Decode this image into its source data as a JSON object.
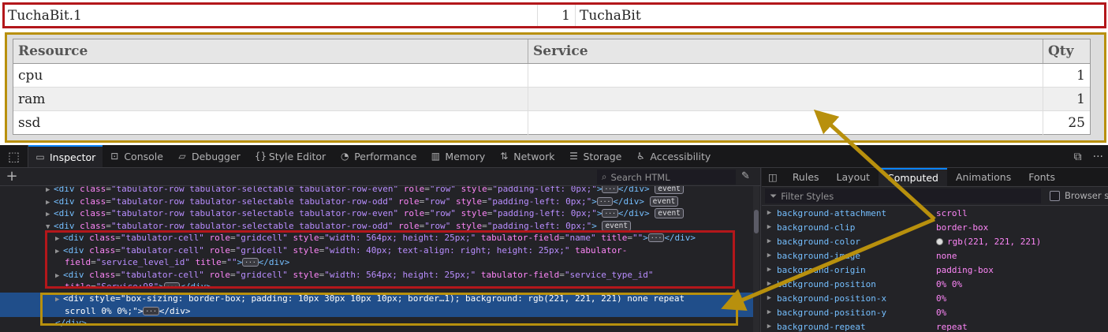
{
  "top_row": {
    "name": "TuchaBit.1",
    "qty": "1",
    "label": "TuchaBit"
  },
  "subtable": {
    "headers": {
      "resource": "Resource",
      "service": "Service",
      "qty": "Qty"
    },
    "rows": [
      {
        "resource": "cpu",
        "service": "",
        "qty": "1"
      },
      {
        "resource": "ram",
        "service": "",
        "qty": "1"
      },
      {
        "resource": "ssd",
        "service": "",
        "qty": "25"
      }
    ]
  },
  "devtools": {
    "tabs": [
      {
        "icon": "inspector-icon",
        "glyph": "▭",
        "label": "Inspector"
      },
      {
        "icon": "console-icon",
        "glyph": "⊡",
        "label": "Console"
      },
      {
        "icon": "debugger-icon",
        "glyph": "▱",
        "label": "Debugger"
      },
      {
        "icon": "style-editor-icon",
        "glyph": "{}",
        "label": "Style Editor"
      },
      {
        "icon": "performance-icon",
        "glyph": "◔",
        "label": "Performance"
      },
      {
        "icon": "memory-icon",
        "glyph": "▥",
        "label": "Memory"
      },
      {
        "icon": "network-icon",
        "glyph": "⇅",
        "label": "Network"
      },
      {
        "icon": "storage-icon",
        "glyph": "☰",
        "label": "Storage"
      },
      {
        "icon": "accessibility-icon",
        "glyph": "♿",
        "label": "Accessibility"
      }
    ],
    "search_placeholder": "Search HTML",
    "side_tabs": {
      "rules": "Rules",
      "layout": "Layout",
      "computed": "Computed",
      "animations": "Animations",
      "fonts": "Fonts"
    },
    "filter_placeholder": "Filter Styles",
    "browser_styles_label": "Browser st",
    "computed_props": [
      {
        "name": "background-attachment",
        "value": "scroll"
      },
      {
        "name": "background-clip",
        "value": "border-box"
      },
      {
        "name": "background-color",
        "value": "rgb(221, 221, 221)",
        "swatch": "#dddddd"
      },
      {
        "name": "background-image",
        "value": "none"
      },
      {
        "name": "background-origin",
        "value": "padding-box"
      },
      {
        "name": "background-position",
        "value": "0% 0%"
      },
      {
        "name": "background-position-x",
        "value": "0%"
      },
      {
        "name": "background-position-y",
        "value": "0%"
      },
      {
        "name": "background-repeat",
        "value": "repeat"
      }
    ]
  },
  "annotation_colors": {
    "red": "#b3171b",
    "gold": "#b8900d"
  }
}
